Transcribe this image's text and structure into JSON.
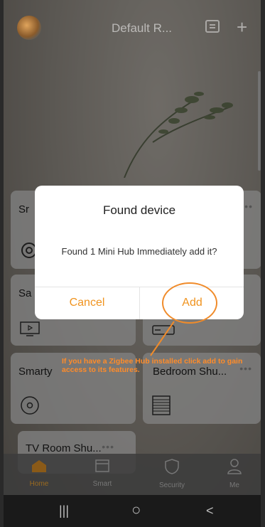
{
  "header": {
    "room": "Default R..."
  },
  "icons": {
    "message": "message-icon",
    "add": "plus-icon"
  },
  "cards": [
    {
      "name": "Sr",
      "dots": "•••",
      "icon": "camera-icon"
    },
    {
      "name": "Sa",
      "dots": "",
      "icon": "tv-icon"
    },
    {
      "name": "",
      "dots": "",
      "icon": "router-icon"
    },
    {
      "name": "Smarty",
      "dots": "",
      "icon": "disc-icon"
    },
    {
      "name": "Bedroom Shu...",
      "dots": "•••",
      "icon": "shutter-icon"
    },
    {
      "name": "TV Room Shu...",
      "dots": "•••",
      "icon": ""
    }
  ],
  "dialog": {
    "title": "Found device",
    "message": "Found 1 Mini Hub Immediately add it?",
    "cancel": "Cancel",
    "add": "Add"
  },
  "annotation": {
    "text": "If you have a Zigbee Hub installed click add to gain access to its features.",
    "color": "#ff8c2a"
  },
  "nav": [
    {
      "label": "Home",
      "icon": "home-icon"
    },
    {
      "label": "Smart",
      "icon": "smart-icon"
    },
    {
      "label": "Security",
      "icon": "shield-icon"
    },
    {
      "label": "Me",
      "icon": "person-icon"
    }
  ],
  "sysnav": {
    "recents": "|||",
    "home": "○",
    "back": "<"
  },
  "colors": {
    "accent": "#f0931e",
    "dialog_bg": "#ffffff"
  }
}
